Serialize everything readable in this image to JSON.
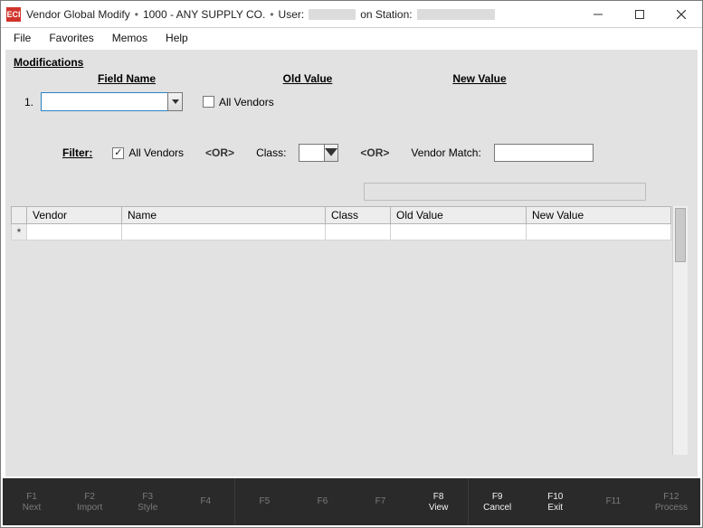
{
  "title": {
    "app_icon_text": "ECI",
    "prefix": "Vendor Global Modify",
    "company": "1000 - ANY SUPPLY CO.",
    "user_label": "User:",
    "station_label": "on Station:"
  },
  "menu": {
    "file": "File",
    "favorites": "Favorites",
    "memos": "Memos",
    "help": "Help"
  },
  "mods": {
    "heading": "Modifications",
    "col_field_name": "Field Name",
    "col_old_value": "Old Value",
    "col_new_value": "New Value",
    "row_number": "1.",
    "all_vendors_label": "All Vendors",
    "all_vendors_checked": false
  },
  "filter": {
    "label": "Filter:",
    "all_vendors_label": "All Vendors",
    "all_vendors_checked": true,
    "or": "<OR>",
    "class_label": "Class:",
    "vendor_match_label": "Vendor Match:"
  },
  "grid": {
    "cols": {
      "vendor": "Vendor",
      "name": "Name",
      "class": "Class",
      "old_value": "Old Value",
      "new_value": "New Value"
    },
    "new_row_marker": "*"
  },
  "fkeys": [
    {
      "key": "F1",
      "label": "Next",
      "active": false
    },
    {
      "key": "F2",
      "label": "Import",
      "active": false
    },
    {
      "key": "F3",
      "label": "Style",
      "active": false
    },
    {
      "key": "F4",
      "label": "",
      "active": false
    },
    {
      "key": "F5",
      "label": "",
      "active": false,
      "sep": true
    },
    {
      "key": "F6",
      "label": "",
      "active": false
    },
    {
      "key": "F7",
      "label": "",
      "active": false
    },
    {
      "key": "F8",
      "label": "View",
      "active": true
    },
    {
      "key": "F9",
      "label": "Cancel",
      "active": true,
      "sep": true
    },
    {
      "key": "F10",
      "label": "Exit",
      "active": true
    },
    {
      "key": "F11",
      "label": "",
      "active": false
    },
    {
      "key": "F12",
      "label": "Process",
      "active": false
    }
  ]
}
